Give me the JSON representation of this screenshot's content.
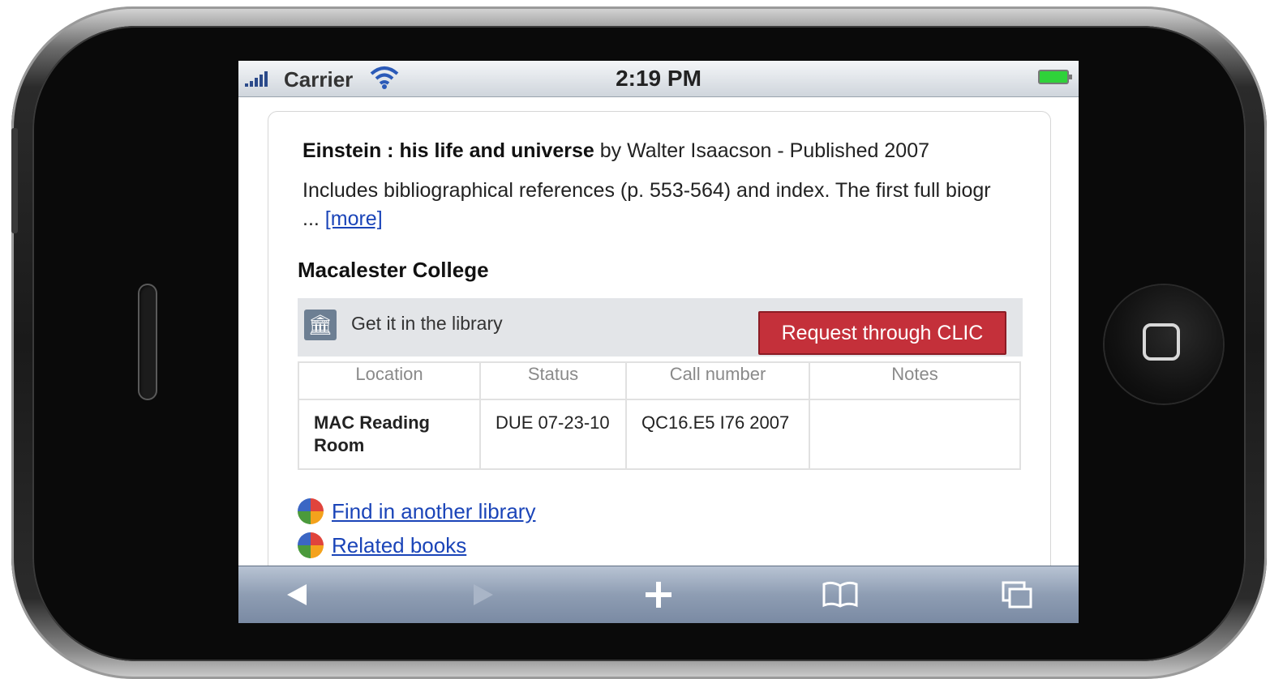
{
  "status_bar": {
    "carrier": "Carrier",
    "time": "2:19 PM"
  },
  "record": {
    "title": "Einstein : his life and universe",
    "byline": " by Walter Isaacson - Published 2007",
    "description": "Includes bibliographical references (p. 553-564) and index. The first full biogr ... ",
    "more_link": "[more]"
  },
  "library": {
    "name": "Macalester College",
    "get_it_label": "Get it in the library",
    "request_button": "Request through CLIC",
    "columns": [
      "Location",
      "Status",
      "Call number",
      "Notes"
    ],
    "rows": [
      {
        "location": "MAC Reading Room",
        "status": "DUE 07-23-10",
        "call_number": "QC16.E5 I76 2007",
        "notes": ""
      }
    ]
  },
  "links": [
    {
      "label": "Find in another library"
    },
    {
      "label": "Related books"
    }
  ],
  "toolbar": {
    "back_icon": "back-arrow-icon",
    "forward_icon": "forward-arrow-icon",
    "add_icon": "plus-icon",
    "bookmarks_icon": "book-icon",
    "pages_icon": "pages-icon"
  },
  "colors": {
    "request_button": "#c4303a",
    "link": "#1a44b8",
    "battery": "#2fd23a"
  }
}
